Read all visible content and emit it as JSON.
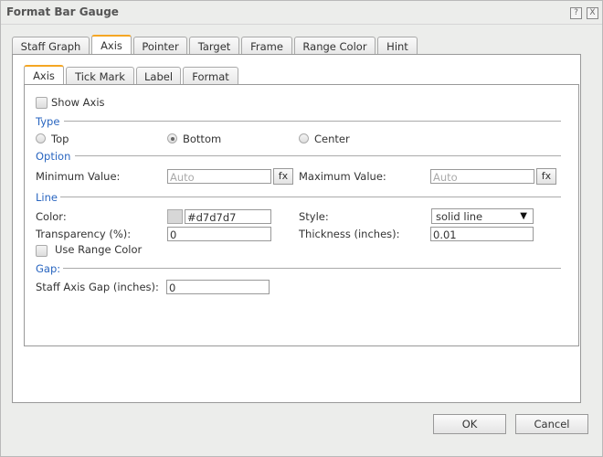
{
  "dialog": {
    "title": "Format Bar Gauge",
    "help_label": "?",
    "close_label": "X"
  },
  "tabs": [
    {
      "label": "Staff Graph"
    },
    {
      "label": "Axis"
    },
    {
      "label": "Pointer"
    },
    {
      "label": "Target"
    },
    {
      "label": "Frame"
    },
    {
      "label": "Range Color"
    },
    {
      "label": "Hint"
    }
  ],
  "active_tab": "Axis",
  "subtabs": [
    {
      "label": "Axis"
    },
    {
      "label": "Tick Mark"
    },
    {
      "label": "Label"
    },
    {
      "label": "Format"
    }
  ],
  "active_subtab": "Axis",
  "axis": {
    "show_axis_label": "Show Axis",
    "show_axis_checked": false,
    "type": {
      "section_label": "Type",
      "options": [
        {
          "label": "Top",
          "selected": false
        },
        {
          "label": "Bottom",
          "selected": true
        },
        {
          "label": "Center",
          "selected": false
        }
      ]
    },
    "option": {
      "section_label": "Option",
      "min_label": "Minimum Value:",
      "min_placeholder": "Auto",
      "max_label": "Maximum Value:",
      "max_placeholder": "Auto",
      "fx_label": "fx"
    },
    "line": {
      "section_label": "Line",
      "color_label": "Color:",
      "color_value": "#d7d7d7",
      "style_label": "Style:",
      "style_value": "solid line",
      "transparency_label": "Transparency (%):",
      "transparency_value": "0",
      "thickness_label": "Thickness (inches):",
      "thickness_value": "0.01",
      "use_range_color_label": "Use Range Color",
      "use_range_color_checked": false
    },
    "gap": {
      "section_label": "Gap:",
      "staff_axis_gap_label": "Staff Axis Gap (inches):",
      "staff_axis_gap_value": "0"
    }
  },
  "footer": {
    "ok_label": "OK",
    "cancel_label": "Cancel"
  },
  "colors": {
    "accent_tab": "#f5a623",
    "section_text": "#2a66c0"
  }
}
